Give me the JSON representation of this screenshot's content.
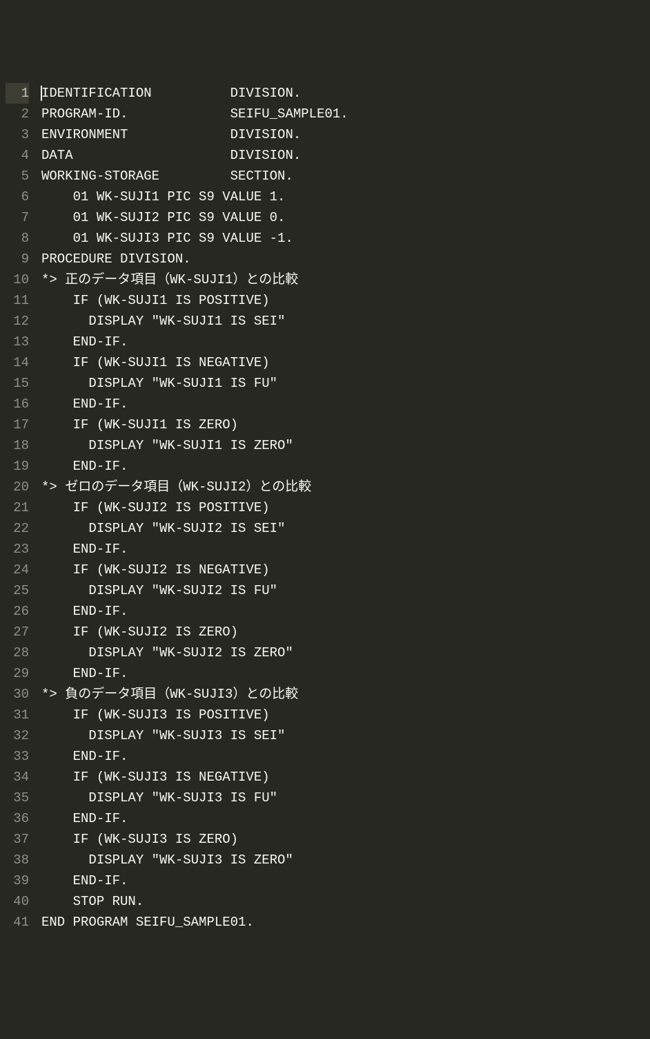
{
  "selectedLine": 1,
  "lines": [
    "IDENTIFICATION          DIVISION.",
    "PROGRAM-ID.             SEIFU_SAMPLE01.",
    "ENVIRONMENT             DIVISION.",
    "DATA                    DIVISION.",
    "WORKING-STORAGE         SECTION.",
    "    01 WK-SUJI1 PIC S9 VALUE 1.",
    "    01 WK-SUJI2 PIC S9 VALUE 0.",
    "    01 WK-SUJI3 PIC S9 VALUE -1.",
    "PROCEDURE DIVISION.",
    "*> 正のデータ項目（WK-SUJI1）との比較",
    "    IF (WK-SUJI1 IS POSITIVE)",
    "      DISPLAY \"WK-SUJI1 IS SEI\"",
    "    END-IF.",
    "    IF (WK-SUJI1 IS NEGATIVE)",
    "      DISPLAY \"WK-SUJI1 IS FU\"",
    "    END-IF.",
    "    IF (WK-SUJI1 IS ZERO)",
    "      DISPLAY \"WK-SUJI1 IS ZERO\"",
    "    END-IF.",
    "*> ゼロのデータ項目（WK-SUJI2）との比較",
    "    IF (WK-SUJI2 IS POSITIVE)",
    "      DISPLAY \"WK-SUJI2 IS SEI\"",
    "    END-IF.",
    "    IF (WK-SUJI2 IS NEGATIVE)",
    "      DISPLAY \"WK-SUJI2 IS FU\"",
    "    END-IF.",
    "    IF (WK-SUJI2 IS ZERO)",
    "      DISPLAY \"WK-SUJI2 IS ZERO\"",
    "    END-IF.",
    "*> 負のデータ項目（WK-SUJI3）との比較",
    "    IF (WK-SUJI3 IS POSITIVE)",
    "      DISPLAY \"WK-SUJI3 IS SEI\"",
    "    END-IF.",
    "    IF (WK-SUJI3 IS NEGATIVE)",
    "      DISPLAY \"WK-SUJI3 IS FU\"",
    "    END-IF.",
    "    IF (WK-SUJI3 IS ZERO)",
    "      DISPLAY \"WK-SUJI3 IS ZERO\"",
    "    END-IF.",
    "    STOP RUN.",
    "END PROGRAM SEIFU_SAMPLE01."
  ]
}
